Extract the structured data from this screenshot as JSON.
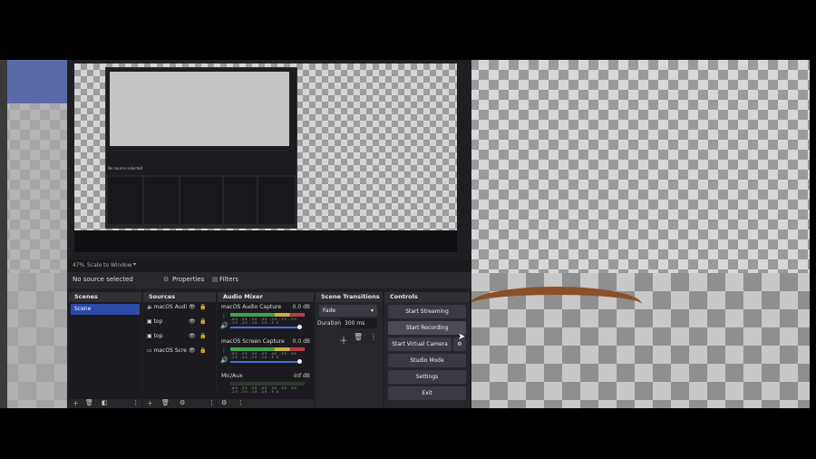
{
  "preview_toolbar": {
    "zoom": "47%",
    "scale_mode": "Scale to Window"
  },
  "source_bar": {
    "status": "No source selected",
    "properties_label": "Properties",
    "filters_label": "Filters"
  },
  "nested_text": {
    "status": "No source selected"
  },
  "docks": {
    "scenes": {
      "title": "Scenes",
      "items": [
        "Scene"
      ]
    },
    "sources": {
      "title": "Sources",
      "items": [
        "macOS Audi",
        "top",
        "top",
        "macOS Scre"
      ]
    },
    "mixer": {
      "title": "Audio Mixer",
      "channels": [
        {
          "name": "macOS Audio Capture",
          "db": "0.0 dB",
          "level": 0.75
        },
        {
          "name": "macOS Screen Capture",
          "db": "0.0 dB",
          "level": 0.75
        },
        {
          "name": "Mic/Aux",
          "db": "-inf dB",
          "level": 0.0
        }
      ],
      "ticks": "-60 -55 -50 -45 -40 -35 -30 -25 -20 -15 -10 -5 0"
    },
    "transitions": {
      "title": "Scene Transitions",
      "selected": "Fade",
      "duration_label": "Duration",
      "duration_value": "300 ms"
    },
    "controls": {
      "title": "Controls",
      "buttons": [
        "Start Streaming",
        "Start Recording",
        "Start Virtual Camera",
        "Studio Mode",
        "Settings",
        "Exit"
      ]
    }
  },
  "colors": {
    "accent": "#2c4ba8",
    "dock_bg": "#26262b",
    "plank": "#8a5028"
  }
}
